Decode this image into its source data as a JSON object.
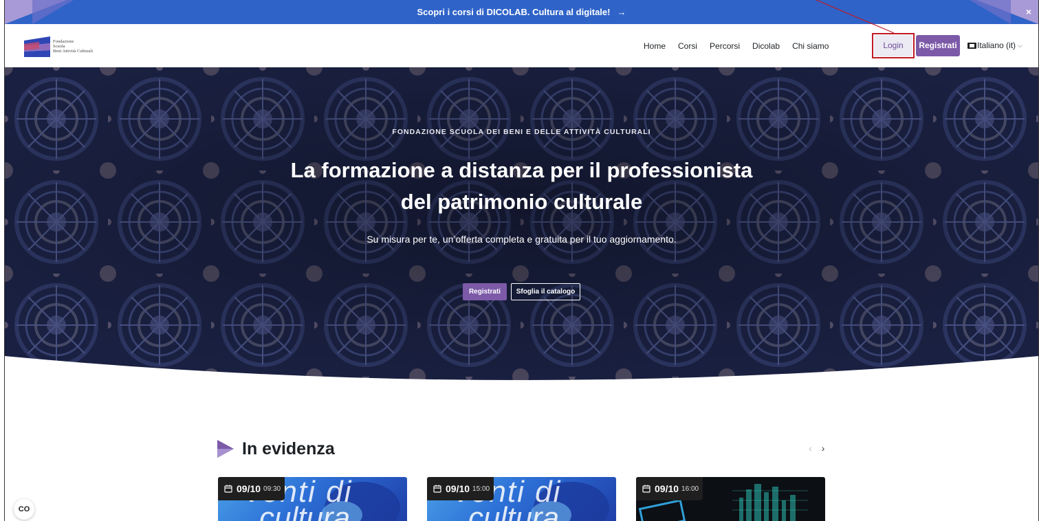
{
  "announcement": {
    "text": "Scopri i corsi di DICOLAB. Cultura al digitale!",
    "arrow": "→",
    "close": "×"
  },
  "navbar": {
    "logo_lines": [
      "Fondazione",
      "Scuola",
      "Beni Attività Culturali"
    ],
    "links": [
      "Home",
      "Corsi",
      "Percorsi",
      "Dicolab",
      "Chi siamo"
    ],
    "login_label": "Login",
    "register_label": "Registrati",
    "language_label": "Italiano (it)"
  },
  "hero": {
    "eyebrow": "FONDAZIONE SCUOLA DEI BENI E DELLE ATTIVITÀ CULTURALI",
    "title_line1": "La formazione a distanza per il professionista",
    "title_line2": "del patrimonio culturale",
    "subtitle": "Su misura per te, un’offerta completa e gratuita per il tuo aggiornamento.",
    "cta_register": "Registrati",
    "cta_catalog": "Sfoglia il catalogo"
  },
  "featured": {
    "title": "In evidenza",
    "prev": "‹",
    "next": "›",
    "cards": [
      {
        "date": "09/10",
        "time": "09:30",
        "art_text_1": "venti di",
        "art_text_2": "cultura"
      },
      {
        "date": "09/10",
        "time": "15:00",
        "art_text_1": "venti di",
        "art_text_2": "cultura"
      },
      {
        "date": "09/10",
        "time": "16:00"
      }
    ]
  },
  "cc_badge": "CO",
  "colors": {
    "announce_bg": "#2f63c8",
    "brand_purple": "#7c5aa8",
    "hero_bg": "#1a2140",
    "highlight_red": "#c01a24"
  }
}
